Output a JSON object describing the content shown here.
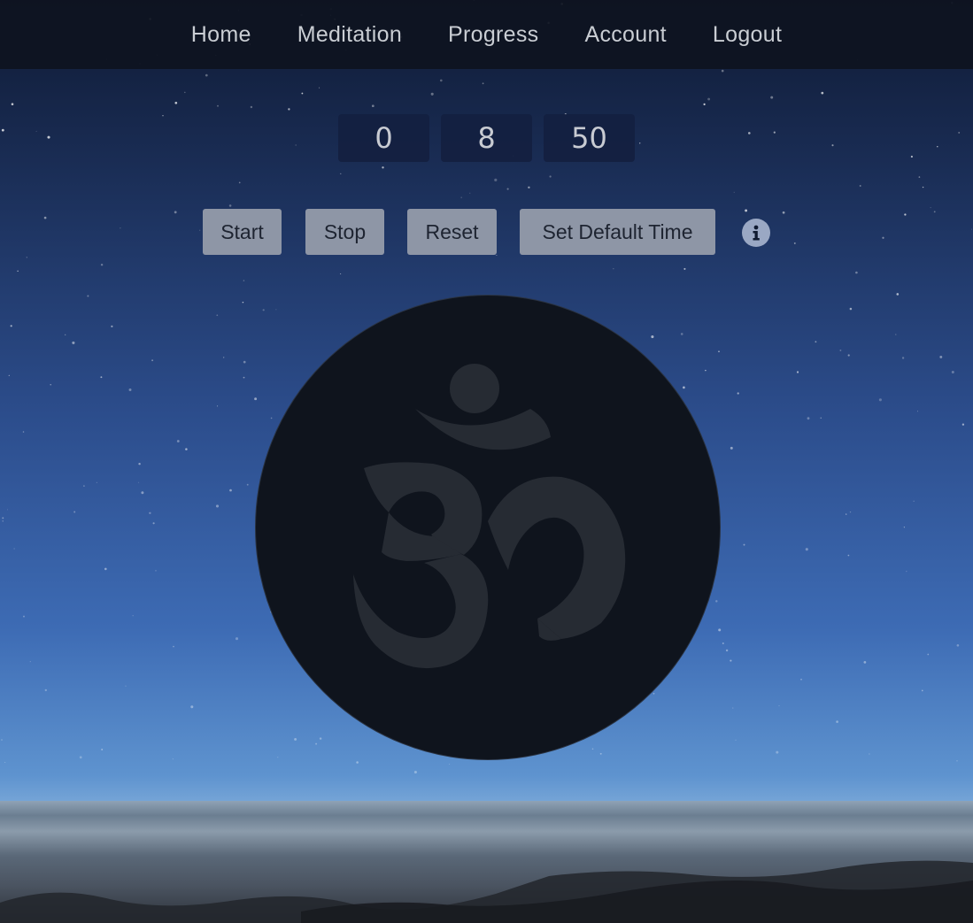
{
  "nav": {
    "items": [
      {
        "label": "Home"
      },
      {
        "label": "Meditation"
      },
      {
        "label": "Progress"
      },
      {
        "label": "Account"
      },
      {
        "label": "Logout"
      }
    ]
  },
  "timer": {
    "hours": "0",
    "minutes": "8",
    "seconds": "50"
  },
  "controls": {
    "start_label": "Start",
    "stop_label": "Stop",
    "reset_label": "Reset",
    "default_label": "Set Default Time"
  },
  "icons": {
    "info": "info-icon",
    "om": "om-icon"
  },
  "colors": {
    "nav_bg": "#0e1320",
    "button_bg": "#8e96a6",
    "timer_bg": "#142040",
    "circle_bg": "#0f141d",
    "om_glyph": "#262b33"
  }
}
